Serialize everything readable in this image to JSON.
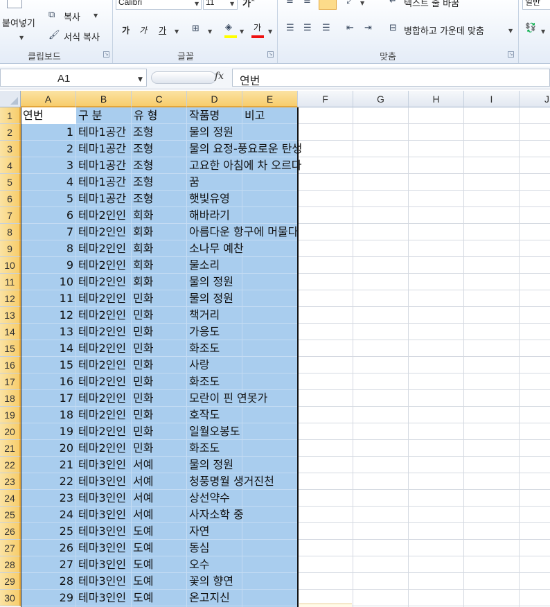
{
  "ribbon": {
    "clipboard": {
      "paste_label": "붙여넣기",
      "copy_label": "복사",
      "format_painter_label": "서식 복사",
      "group_label": "클립보드"
    },
    "font": {
      "font_name": "Calibri",
      "font_size": "11",
      "bold": "가",
      "italic": "가",
      "underline": "가",
      "font_color": "가",
      "group_label": "글꼴"
    },
    "alignment": {
      "wrap_text_label": "텍스트 줄 바꿈",
      "merge_label": "병합하고 가운데 맞춤",
      "group_label": "맞춤"
    },
    "number": {
      "format_label": "일반"
    }
  },
  "formula_bar": {
    "name_box": "A1",
    "fx": "fx",
    "formula": "연번"
  },
  "columns": [
    "A",
    "B",
    "C",
    "D",
    "E",
    "F",
    "G",
    "H",
    "I",
    "J"
  ],
  "header_row": [
    "연번",
    "구 분",
    "유 형",
    "작품명",
    "비고"
  ],
  "rows": [
    {
      "n": "1",
      "b": "테마1공간",
      "c": "조형",
      "d": "물의 정원"
    },
    {
      "n": "2",
      "b": "테마1공간",
      "c": "조형",
      "d": "물의 요정-풍요로운 탄생"
    },
    {
      "n": "3",
      "b": "테마1공간",
      "c": "조형",
      "d": "고요한 아침에 차 오르다"
    },
    {
      "n": "4",
      "b": "테마1공간",
      "c": "조형",
      "d": "꿈"
    },
    {
      "n": "5",
      "b": "테마1공간",
      "c": "조형",
      "d": "햇빛유영"
    },
    {
      "n": "6",
      "b": "테마2인인",
      "c": "회화",
      "d": "해바라기"
    },
    {
      "n": "7",
      "b": "테마2인인",
      "c": "회화",
      "d": "아름다운 항구에 머물다"
    },
    {
      "n": "8",
      "b": "테마2인인",
      "c": "회화",
      "d": "소나무 예찬"
    },
    {
      "n": "9",
      "b": "테마2인인",
      "c": "회화",
      "d": "물소리"
    },
    {
      "n": "10",
      "b": "테마2인인",
      "c": "회화",
      "d": "물의 정원"
    },
    {
      "n": "11",
      "b": "테마2인인",
      "c": "민화",
      "d": "물의 정원"
    },
    {
      "n": "12",
      "b": "테마2인인",
      "c": "민화",
      "d": "책거리"
    },
    {
      "n": "13",
      "b": "테마2인인",
      "c": "민화",
      "d": "가응도"
    },
    {
      "n": "14",
      "b": "테마2인인",
      "c": "민화",
      "d": "화조도"
    },
    {
      "n": "15",
      "b": "테마2인인",
      "c": "민화",
      "d": "사랑"
    },
    {
      "n": "16",
      "b": "테마2인인",
      "c": "민화",
      "d": "화조도"
    },
    {
      "n": "17",
      "b": "테마2인인",
      "c": "민화",
      "d": "모란이 핀 연못가"
    },
    {
      "n": "18",
      "b": "테마2인인",
      "c": "민화",
      "d": "호작도"
    },
    {
      "n": "19",
      "b": "테마2인인",
      "c": "민화",
      "d": "일월오봉도"
    },
    {
      "n": "20",
      "b": "테마2인인",
      "c": "민화",
      "d": "화조도"
    },
    {
      "n": "21",
      "b": "테마3인인",
      "c": "서예",
      "d": "물의 정원"
    },
    {
      "n": "22",
      "b": "테마3인인",
      "c": "서예",
      "d": "청풍명월 생거진천"
    },
    {
      "n": "23",
      "b": "테마3인인",
      "c": "서예",
      "d": "상선약수"
    },
    {
      "n": "24",
      "b": "테마3인인",
      "c": "서예",
      "d": "사자소학 중"
    },
    {
      "n": "25",
      "b": "테마3인인",
      "c": "도예",
      "d": "자연"
    },
    {
      "n": "26",
      "b": "테마3인인",
      "c": "도예",
      "d": "동심"
    },
    {
      "n": "27",
      "b": "테마3인인",
      "c": "도예",
      "d": "오수"
    },
    {
      "n": "28",
      "b": "테마3인인",
      "c": "도예",
      "d": "꽃의 향연"
    },
    {
      "n": "29",
      "b": "테마3인인",
      "c": "도예",
      "d": "온고지신"
    }
  ],
  "colors": {
    "selection_fill": "#a9cdee",
    "header_selected": "#f7cd6c",
    "header_normal": "#e2e8f1"
  }
}
